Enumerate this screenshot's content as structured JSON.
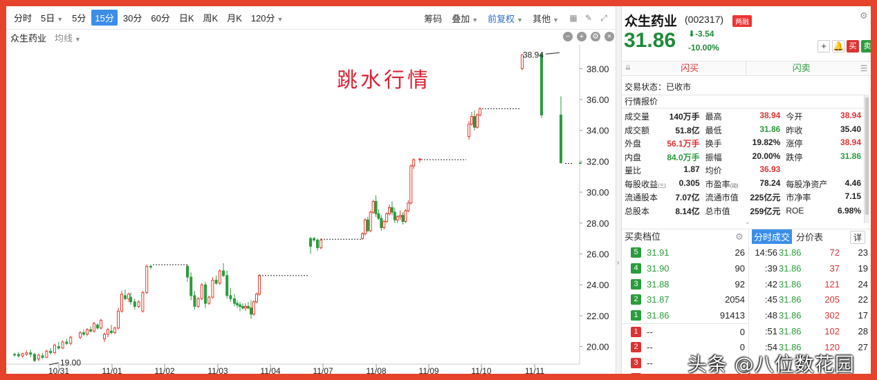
{
  "toolbar": {
    "periods": [
      "分时",
      "5日",
      "5分",
      "15分",
      "30分",
      "60分",
      "日K",
      "周K",
      "月K",
      "120分"
    ],
    "active_period": "15分",
    "chips": "筹码",
    "overlay": "叠加",
    "adjust": "前复权",
    "other": "其他"
  },
  "subbar": {
    "stock": "众生药业",
    "avg": "均线"
  },
  "annotation": "跳水行情",
  "chart_data": {
    "type": "candlestick",
    "ylim": [
      19.0,
      39.4
    ],
    "y_ticks": [
      "38.00",
      "36.00",
      "34.00",
      "32.00",
      "30.00",
      "28.00",
      "26.00",
      "24.00",
      "22.00",
      "20.00"
    ],
    "x_labels": [
      "10/31",
      "11/01",
      "11/02",
      "11/03",
      "11/04",
      "11/07",
      "11/08",
      "11/09",
      "11/10",
      "11/11"
    ],
    "max_label": "38.94",
    "min_label": "19.00",
    "colors": {
      "up": "#e33a2c",
      "down": "#2a9c3c"
    },
    "sessions": [
      {
        "day": "10/31",
        "candles": [
          [
            19.5,
            19.6,
            19.45,
            19.35,
            "d"
          ],
          [
            19.5,
            19.65,
            19.4,
            19.3,
            "d"
          ],
          [
            19.4,
            19.6,
            19.55,
            19.3,
            "u"
          ],
          [
            19.5,
            19.75,
            19.6,
            19.4,
            "u"
          ],
          [
            19.6,
            19.8,
            19.5,
            19.3,
            "d"
          ],
          [
            19.5,
            19.6,
            19.1,
            19.0,
            "d"
          ],
          [
            19.2,
            19.55,
            19.45,
            19.05,
            "u"
          ],
          [
            19.4,
            19.6,
            19.3,
            19.2,
            "d"
          ],
          [
            19.3,
            19.8,
            19.7,
            19.25,
            "u"
          ],
          [
            19.7,
            19.9,
            19.6,
            19.5,
            "d"
          ],
          [
            19.6,
            20.2,
            20.1,
            19.5,
            "u"
          ],
          [
            20.0,
            20.3,
            19.9,
            19.8,
            "d"
          ],
          [
            19.9,
            20.4,
            20.3,
            19.85,
            "u"
          ],
          [
            20.3,
            20.5,
            20.2,
            20.1,
            "d"
          ],
          [
            20.2,
            20.7,
            20.6,
            20.1,
            "u"
          ]
        ]
      },
      {
        "day": "11/01",
        "candles": [
          [
            20.6,
            21.0,
            20.9,
            20.5,
            "u"
          ],
          [
            20.9,
            21.1,
            20.8,
            20.7,
            "d"
          ],
          [
            20.8,
            21.2,
            21.1,
            20.7,
            "u"
          ],
          [
            21.1,
            21.3,
            21.0,
            20.9,
            "d"
          ],
          [
            21.0,
            21.6,
            21.5,
            20.9,
            "u"
          ],
          [
            21.4,
            21.5,
            21.2,
            21.1,
            "d"
          ],
          [
            21.2,
            21.8,
            21.7,
            21.1,
            "u"
          ],
          [
            20.5,
            20.9,
            20.8,
            20.3,
            "u"
          ],
          [
            20.8,
            21.2,
            21.1,
            20.6,
            "u"
          ],
          [
            21.0,
            21.4,
            20.9,
            20.8,
            "d"
          ],
          [
            20.9,
            21.3,
            21.2,
            20.8,
            "u"
          ],
          [
            21.2,
            22.5,
            22.3,
            21.1,
            "u"
          ],
          [
            22.3,
            23.6,
            23.4,
            22.2,
            "u"
          ],
          [
            23.3,
            23.7,
            23.1,
            23.0,
            "d"
          ],
          [
            23.1,
            23.5,
            23.4,
            22.9,
            "u"
          ]
        ]
      },
      {
        "day": "11/02",
        "candles": [
          [
            23.2,
            23.5,
            22.9,
            22.7,
            "d"
          ],
          [
            22.9,
            23.1,
            22.6,
            22.4,
            "d"
          ],
          [
            22.6,
            23.0,
            22.9,
            22.5,
            "u"
          ],
          [
            22.3,
            23.6,
            23.5,
            22.2,
            "u"
          ],
          [
            23.5,
            25.3,
            25.2,
            23.4,
            "u"
          ],
          [
            25.2,
            25.3,
            25.15,
            25.0,
            "d"
          ]
        ]
      },
      {
        "day": "11/02b",
        "candles": [
          [
            25.2,
            25.3,
            24.5,
            24.2,
            "d"
          ],
          [
            24.5,
            24.8,
            23.3,
            23.0,
            "d"
          ],
          [
            23.3,
            23.6,
            22.6,
            22.4,
            "d"
          ],
          [
            22.6,
            23.2,
            23.1,
            22.5,
            "u"
          ],
          [
            23.1,
            24.1,
            24.0,
            23.0,
            "u"
          ],
          [
            24.0,
            24.2,
            22.8,
            22.5,
            "d"
          ],
          [
            22.8,
            23.3,
            23.2,
            22.7,
            "u"
          ],
          [
            23.2,
            24.5,
            24.3,
            23.1,
            "u"
          ],
          [
            24.3,
            24.6,
            24.1,
            24.0,
            "d"
          ],
          [
            24.1,
            25.0,
            24.9,
            24.0,
            "u"
          ],
          [
            24.9,
            25.4,
            24.6,
            24.5,
            "d"
          ],
          [
            24.6,
            24.9,
            23.3,
            23.1,
            "d"
          ],
          [
            23.3,
            23.8,
            23.1,
            22.9,
            "d"
          ]
        ]
      },
      {
        "day": "11/03",
        "candles": [
          [
            23.1,
            23.4,
            22.8,
            22.6,
            "d"
          ],
          [
            22.8,
            23.0,
            22.7,
            22.5,
            "d"
          ],
          [
            22.7,
            22.9,
            22.6,
            22.3,
            "d"
          ],
          [
            22.6,
            22.8,
            22.5,
            22.4,
            "d"
          ],
          [
            22.5,
            22.8,
            22.6,
            22.3,
            "u"
          ],
          [
            22.6,
            22.9,
            22.5,
            22.4,
            "d"
          ],
          [
            22.5,
            23.0,
            22.1,
            21.8,
            "d"
          ],
          [
            22.1,
            23.0,
            22.9,
            22.0,
            "u"
          ],
          [
            22.9,
            23.5,
            23.4,
            22.8,
            "u"
          ],
          [
            23.4,
            24.7,
            24.6,
            23.3,
            "u"
          ]
        ]
      },
      {
        "day": "11/07",
        "candles": [
          [
            26.5,
            27.1,
            27.0,
            26.0,
            "d"
          ],
          [
            27.0,
            27.1,
            26.9,
            26.8,
            "d"
          ],
          [
            26.9,
            27.0,
            26.4,
            26.2,
            "d"
          ],
          [
            26.4,
            27.0,
            26.9,
            26.3,
            "u"
          ]
        ]
      },
      {
        "day": "11/08",
        "candles": [
          [
            27.0,
            27.4,
            27.3,
            26.9,
            "u"
          ],
          [
            27.3,
            28.3,
            28.2,
            27.2,
            "u"
          ],
          [
            28.2,
            28.4,
            27.5,
            27.4,
            "d"
          ],
          [
            27.5,
            28.8,
            28.7,
            27.4,
            "u"
          ],
          [
            28.7,
            29.5,
            29.4,
            28.6,
            "u"
          ],
          [
            29.4,
            29.8,
            28.6,
            28.4,
            "d"
          ],
          [
            28.6,
            28.9,
            28.3,
            28.2,
            "d"
          ],
          [
            28.3,
            28.5,
            27.7,
            27.5,
            "d"
          ],
          [
            27.7,
            28.2,
            28.1,
            27.6,
            "u"
          ],
          [
            28.1,
            28.7,
            28.6,
            28.0,
            "u"
          ],
          [
            28.6,
            29.2,
            29.0,
            28.5,
            "u"
          ],
          [
            29.0,
            29.4,
            28.7,
            28.5,
            "d"
          ],
          [
            28.7,
            29.0,
            28.2,
            28.0,
            "d"
          ],
          [
            28.2,
            28.5,
            28.4,
            28.0,
            "u"
          ],
          [
            28.4,
            28.8,
            28.5,
            28.2,
            "u"
          ],
          [
            28.5,
            28.7,
            28.1,
            27.9,
            "d"
          ],
          [
            28.1,
            28.9,
            28.8,
            28.0,
            "u"
          ],
          [
            28.8,
            29.5,
            29.3,
            28.7,
            "u"
          ],
          [
            29.3,
            31.8,
            31.7,
            29.2,
            "u"
          ],
          [
            31.7,
            32.2,
            32.1,
            31.5,
            "u"
          ]
        ]
      },
      {
        "day": "11/09",
        "candles": [
          [
            32.1,
            32.2,
            32.15,
            31.9,
            "u"
          ]
        ]
      },
      {
        "day": "11/10",
        "candles": [
          [
            33.6,
            34.6,
            34.4,
            33.4,
            "u"
          ],
          [
            34.4,
            35.2,
            34.9,
            34.3,
            "u"
          ],
          [
            34.9,
            35.3,
            34.2,
            34.0,
            "d"
          ],
          [
            34.2,
            35.1,
            35.0,
            34.1,
            "u"
          ],
          [
            35.0,
            35.5,
            35.4,
            34.9,
            "u"
          ]
        ]
      },
      {
        "day": "11/11",
        "candles": [
          [
            38.0,
            38.9,
            38.9,
            37.9,
            "u"
          ],
          [
            38.94,
            38.94,
            35.0,
            34.8,
            "d"
          ],
          [
            35.0,
            36.2,
            31.9,
            31.86,
            "d"
          ],
          [
            31.9,
            31.9,
            31.86,
            31.86,
            "d"
          ]
        ]
      }
    ],
    "limit_lines": [
      {
        "from": "11/02",
        "price": 25.3
      },
      {
        "from": "11/04",
        "price": 24.6
      },
      {
        "from": "11/07",
        "price": 26.95
      },
      {
        "from": "11/09",
        "price": 32.1
      },
      {
        "from": "11/10",
        "price": 35.4
      },
      {
        "from": "11/11",
        "price": 31.86
      }
    ]
  },
  "quote": {
    "name": "众生药业",
    "code": "(002317)",
    "badge": "两融",
    "price": "31.86",
    "change": "-3.54",
    "pct": "-10.00%",
    "plus": "+",
    "bell": "🔔",
    "buy_btn": "买",
    "sell_btn": "卖",
    "flash_buy": "闪买",
    "flash_sell": "闪卖",
    "status": "交易状态：已收市",
    "section": "行情报价",
    "rows": [
      [
        [
          "成交量",
          "140万手",
          ""
        ],
        [
          "最高",
          "38.94",
          "red"
        ],
        [
          "今开",
          "38.94",
          "red"
        ]
      ],
      [
        [
          "成交额",
          "51.8亿",
          ""
        ],
        [
          "最低",
          "31.86",
          "green"
        ],
        [
          "昨收",
          "35.40",
          ""
        ]
      ],
      [
        [
          "外盘",
          "56.1万手",
          "red"
        ],
        [
          "换手",
          "19.82%",
          ""
        ],
        [
          "涨停",
          "38.94",
          "red"
        ]
      ],
      [
        [
          "内盘",
          "84.0万手",
          "green"
        ],
        [
          "振幅",
          "20.00%",
          ""
        ],
        [
          "跌停",
          "31.86",
          "green"
        ]
      ],
      [
        [
          "量比",
          "1.87",
          ""
        ],
        [
          "均价",
          "36.93",
          "red"
        ],
        [
          "",
          "",
          ""
        ]
      ],
      [
        [
          "每股收益",
          "0.305",
          ""
        ],
        [
          "市盈率",
          "78.24",
          ""
        ],
        [
          "每股净资产",
          "4.46",
          ""
        ]
      ],
      [
        [
          "流通股本",
          "7.07亿",
          ""
        ],
        [
          "流通市值",
          "225亿元",
          ""
        ],
        [
          "市净率",
          "7.15",
          ""
        ]
      ],
      [
        [
          "总股本",
          "8.14亿",
          ""
        ],
        [
          "总市值",
          "259亿元",
          ""
        ],
        [
          "ROE",
          "6.98%",
          ""
        ]
      ]
    ],
    "eps_sub": "(三)",
    "pe_sub": "(动)"
  },
  "orderbook": {
    "title": "买卖档位",
    "bids": [
      {
        "n": "5",
        "price": "31.91",
        "vol": "26"
      },
      {
        "n": "4",
        "price": "31.90",
        "vol": "90"
      },
      {
        "n": "3",
        "price": "31.88",
        "vol": "92"
      },
      {
        "n": "2",
        "price": "31.87",
        "vol": "2054"
      },
      {
        "n": "1",
        "price": "31.86",
        "vol": "91413"
      }
    ],
    "asks": [
      {
        "n": "1",
        "price": "--",
        "vol": "0"
      },
      {
        "n": "2",
        "price": "--",
        "vol": "0"
      },
      {
        "n": "3",
        "price": "--",
        "vol": ""
      },
      {
        "n": "4",
        "price": "",
        "vol": ""
      }
    ]
  },
  "ticks": {
    "tab1": "分时成交",
    "tab2": "分价表",
    "detail": "详",
    "rows": [
      {
        "t": "14:56",
        "p": "31.86",
        "v": "72",
        "n": "23"
      },
      {
        "t": ":39",
        "p": "31.86",
        "v": "37",
        "n": "19"
      },
      {
        "t": ":42",
        "p": "31.86",
        "v": "121",
        "n": "24"
      },
      {
        "t": ":45",
        "p": "31.86",
        "v": "205",
        "n": "22"
      },
      {
        "t": ":48",
        "p": "31.86",
        "v": "302",
        "n": "17"
      },
      {
        "t": ":51",
        "p": "31.86",
        "v": "102",
        "n": "28"
      },
      {
        "t": ":54",
        "p": "31.86",
        "v": "120",
        "n": "27"
      },
      {
        "t": "",
        "p": "",
        "v": "",
        "n": ""
      }
    ]
  },
  "watermark": "头条 @八位数花园"
}
